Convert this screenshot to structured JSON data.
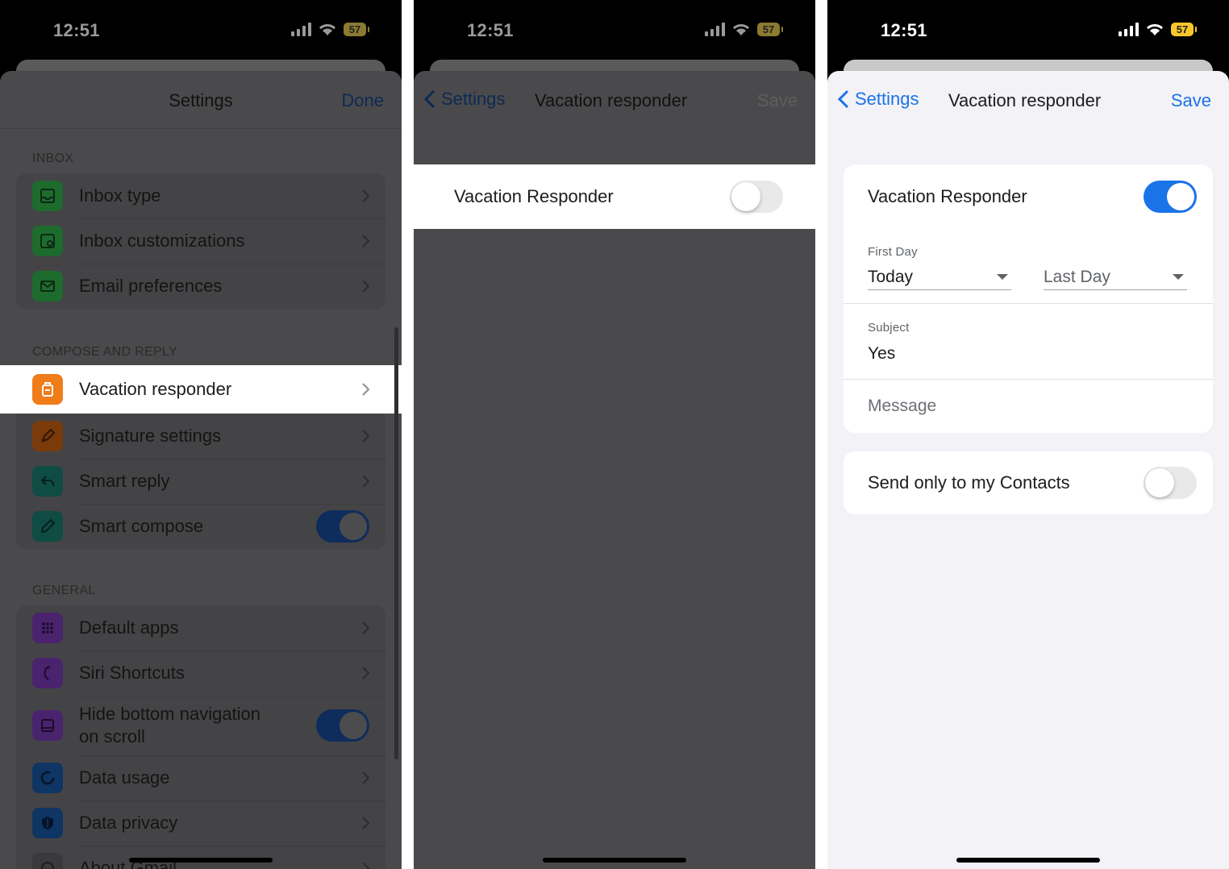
{
  "status": {
    "time": "12:51",
    "battery": "57"
  },
  "panel1": {
    "title": "Settings",
    "done_label": "Done",
    "sections": {
      "inbox": {
        "header": "INBOX",
        "items": [
          {
            "label": "Inbox type",
            "icon": "inbox-icon",
            "color": "#1e6b2e"
          },
          {
            "label": "Inbox customizations",
            "icon": "inbox-settings-icon",
            "color": "#1e6b2e"
          },
          {
            "label": "Email preferences",
            "icon": "mail-icon",
            "color": "#1e6b2e"
          }
        ]
      },
      "compose": {
        "header": "COMPOSE AND REPLY",
        "highlighted": {
          "label": "Vacation responder",
          "icon": "luggage-icon",
          "color": "#f07c1a"
        },
        "items": [
          {
            "label": "Signature settings",
            "icon": "pen-icon",
            "color": "#7a3a0a"
          },
          {
            "label": "Smart reply",
            "icon": "reply-icon",
            "color": "#0f4c44"
          },
          {
            "label": "Smart compose",
            "icon": "pencil-icon",
            "color": "#0f4c44",
            "toggle": true
          }
        ]
      },
      "general": {
        "header": "GENERAL",
        "items": [
          {
            "label": "Default apps",
            "icon": "grid-icon",
            "color": "#4a236e"
          },
          {
            "label": "Siri Shortcuts",
            "icon": "siri-icon",
            "color": "#4a236e"
          },
          {
            "label": "Hide bottom navigation on scroll",
            "icon": "bottom-nav-icon",
            "color": "#4a236e",
            "toggle": true
          },
          {
            "label": "Data usage",
            "icon": "data-usage-icon",
            "color": "#0e3563"
          },
          {
            "label": "Data privacy",
            "icon": "shield-icon",
            "color": "#0e3563"
          },
          {
            "label": "About Gmail",
            "icon": "info-icon",
            "color": "#3a3a3c"
          }
        ]
      }
    }
  },
  "panel2": {
    "back_label": "Settings",
    "title": "Vacation responder",
    "save_label": "Save",
    "toggle_label": "Vacation Responder",
    "toggle_on": false
  },
  "panel3": {
    "back_label": "Settings",
    "title": "Vacation responder",
    "save_label": "Save",
    "toggle_label": "Vacation Responder",
    "toggle_on": true,
    "first_day_label": "First Day",
    "first_day_value": "Today",
    "last_day_value": "Last Day",
    "subject_label": "Subject",
    "subject_value": "Yes",
    "message_placeholder": "Message",
    "contacts_label": "Send only to my Contacts",
    "contacts_on": false
  },
  "colors": {
    "accent": "#1a73e8",
    "dim_overlay": "#4a4a4c"
  }
}
